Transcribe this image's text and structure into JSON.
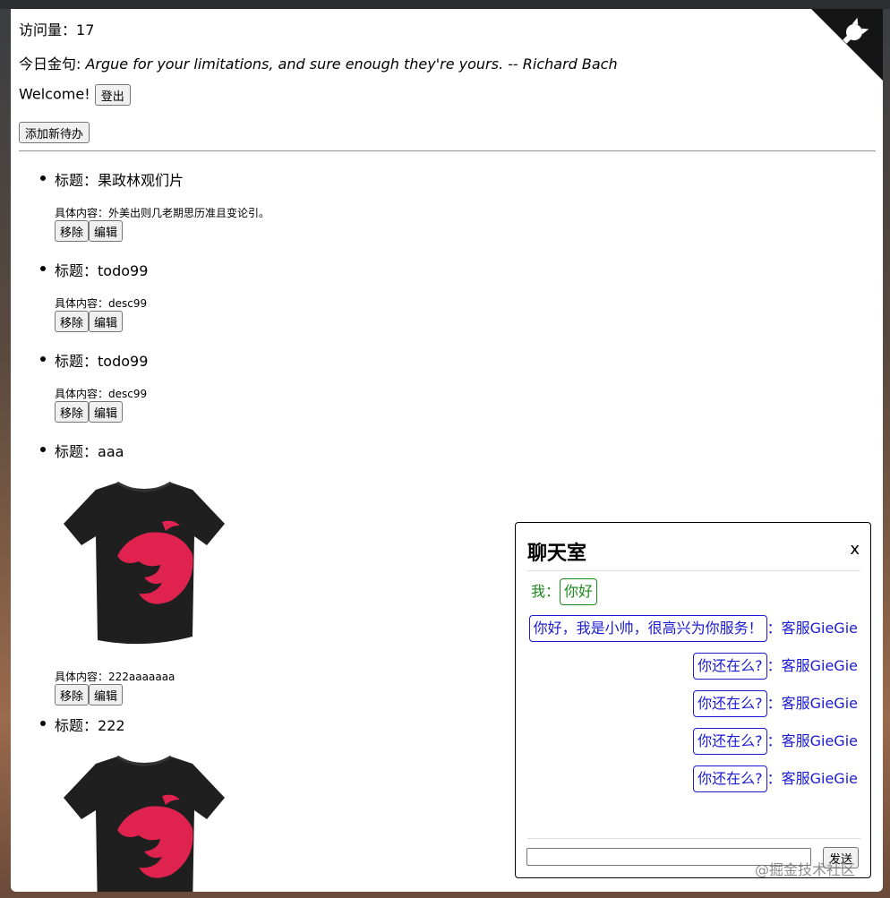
{
  "header": {
    "visits_label": "访问量：",
    "visits_value": "17",
    "quote_label": "今日金句: ",
    "quote_text": "Argue for your limitations, and sure enough they're yours. -- Richard Bach",
    "welcome": "Welcome!",
    "logout_label": "登出",
    "add_label": "添加新待办"
  },
  "todos": [
    {
      "title_label": "标题：",
      "title": "果政林观们片",
      "desc_label": "具体内容：",
      "desc": "外美出则几老期思历准且变论引。",
      "remove": "移除",
      "edit": "编辑"
    },
    {
      "title_label": "标题：",
      "title": "todo99",
      "desc_label": "具体内容：",
      "desc": "desc99",
      "remove": "移除",
      "edit": "编辑"
    },
    {
      "title_label": "标题：",
      "title": "todo99",
      "desc_label": "具体内容：",
      "desc": "desc99",
      "remove": "移除",
      "edit": "编辑"
    },
    {
      "title_label": "标题：",
      "title": "aaa",
      "desc_label": "具体内容：",
      "desc": "222aaaaaaa",
      "remove": "移除",
      "edit": "编辑"
    },
    {
      "title_label": "标题：",
      "title": "222"
    }
  ],
  "chat": {
    "title": "聊天室",
    "close": "x",
    "me_label": "我：",
    "me_msg": "你好",
    "cs_name": "：客服GieGie",
    "cs_msgs": [
      "你好，我是小帅，很高兴为你服务！",
      "你还在么?",
      "你还在么?",
      "你还在么?",
      "你还在么?"
    ],
    "send_label": "发送"
  },
  "watermark": "@掘金技术社区",
  "colors": {
    "me": "#1a8a1a",
    "cs": "#1a1ad0",
    "tshirt": "#1f1f1f",
    "logo": "#e0234e"
  },
  "icons": [
    "github-corner-icon",
    "nestjs-tshirt-image"
  ]
}
